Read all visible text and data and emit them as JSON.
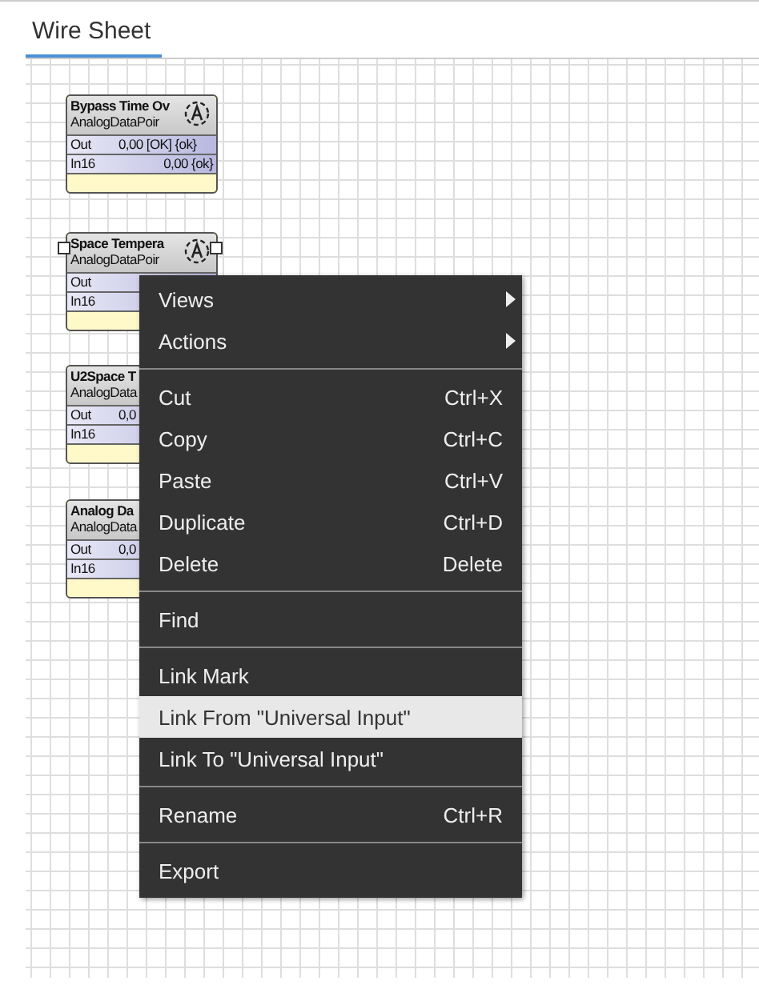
{
  "tabs": [
    {
      "label": "Wire Sheet",
      "selected": true
    }
  ],
  "blocks": [
    {
      "kind": "full",
      "title": "Bypass Time Ov",
      "type": "AnalogDataPoir",
      "selected": false,
      "slots": [
        {
          "name": "Out",
          "value": "0,00 [OK] {ok}"
        },
        {
          "name": "In16",
          "value": "0,00 {ok}"
        }
      ]
    },
    {
      "kind": "full",
      "title": "Space Tempera",
      "type": "AnalogDataPoir",
      "selected": true,
      "slots": [
        {
          "name": "Out"
        },
        {
          "name": "In16"
        }
      ]
    },
    {
      "kind": "covered",
      "title": "U2Space T",
      "type": "AnalogData",
      "selected": false,
      "slots": [
        {
          "name": "Out",
          "value": "0,0"
        },
        {
          "name": "In16"
        }
      ]
    },
    {
      "kind": "covered",
      "title": "Analog Da",
      "type": "AnalogData",
      "selected": false,
      "slots": [
        {
          "name": "Out",
          "value": "0,0"
        },
        {
          "name": "In16"
        }
      ]
    }
  ],
  "context_menu": {
    "groups": [
      [
        {
          "label": "Views",
          "submenu": true,
          "selected": false
        },
        {
          "label": "Actions",
          "submenu": true,
          "selected": false
        }
      ],
      [
        {
          "label": "Cut",
          "shortcut": "Ctrl+X",
          "selected": false
        },
        {
          "label": "Copy",
          "shortcut": "Ctrl+C",
          "selected": false
        },
        {
          "label": "Paste",
          "shortcut": "Ctrl+V",
          "selected": false
        },
        {
          "label": "Duplicate",
          "shortcut": "Ctrl+D",
          "selected": false
        },
        {
          "label": "Delete",
          "shortcut": "Delete",
          "selected": false
        }
      ],
      [
        {
          "label": "Find",
          "selected": false
        }
      ],
      [
        {
          "label": "Link Mark",
          "selected": false
        },
        {
          "label": "Link From \"Universal Input\"",
          "selected": true
        },
        {
          "label": "Link To \"Universal Input\"",
          "selected": false
        }
      ],
      [
        {
          "label": "Rename",
          "shortcut": "Ctrl+R",
          "selected": false
        }
      ],
      [
        {
          "label": "Export",
          "selected": false
        }
      ]
    ]
  }
}
